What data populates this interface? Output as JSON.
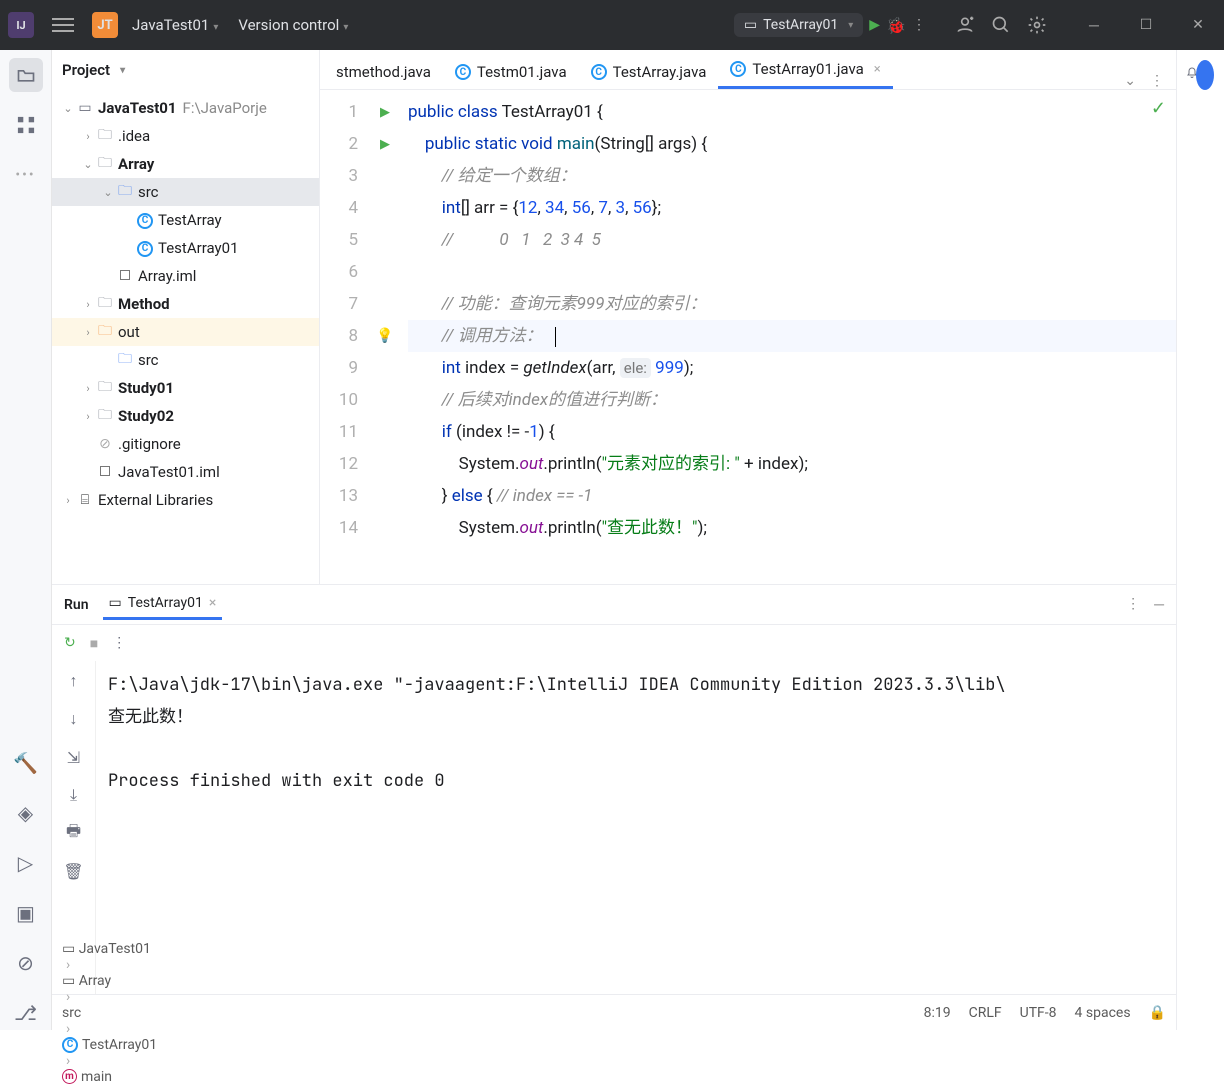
{
  "titlebar": {
    "app_icon": "IJ",
    "project_badge": "JT",
    "project_name": "JavaTest01",
    "vcs_label": "Version control",
    "run_config": "TestArray01"
  },
  "project_panel": {
    "label": "Project",
    "tree": [
      {
        "depth": 0,
        "twisty": "v",
        "icon": "module",
        "label": "JavaTest01",
        "bold": true,
        "path": "F:\\JavaPorje"
      },
      {
        "depth": 1,
        "twisty": ">",
        "icon": "folder",
        "label": ".idea"
      },
      {
        "depth": 1,
        "twisty": "v",
        "icon": "folder",
        "label": "Array",
        "bold": true
      },
      {
        "depth": 2,
        "twisty": "v",
        "icon": "folder-blue",
        "label": "src",
        "sel": true
      },
      {
        "depth": 3,
        "twisty": "",
        "icon": "class",
        "label": "TestArray"
      },
      {
        "depth": 3,
        "twisty": "",
        "icon": "class",
        "label": "TestArray01"
      },
      {
        "depth": 2,
        "twisty": "",
        "icon": "file",
        "label": "Array.iml"
      },
      {
        "depth": 1,
        "twisty": ">",
        "icon": "folder",
        "label": "Method",
        "bold": true
      },
      {
        "depth": 1,
        "twisty": ">",
        "icon": "folder-orange",
        "label": "out",
        "out": true
      },
      {
        "depth": 2,
        "twisty": "",
        "icon": "folder-blue",
        "label": "src"
      },
      {
        "depth": 1,
        "twisty": ">",
        "icon": "folder",
        "label": "Study01",
        "bold": true
      },
      {
        "depth": 1,
        "twisty": ">",
        "icon": "folder",
        "label": "Study02",
        "bold": true
      },
      {
        "depth": 1,
        "twisty": "",
        "icon": "ignore",
        "label": ".gitignore"
      },
      {
        "depth": 1,
        "twisty": "",
        "icon": "file",
        "label": "JavaTest01.iml"
      },
      {
        "depth": 0,
        "twisty": ">",
        "icon": "lib",
        "label": "External Libraries"
      }
    ]
  },
  "tabs": [
    {
      "label": "stmethod.java",
      "icon": "none"
    },
    {
      "label": "Testm01.java",
      "icon": "class"
    },
    {
      "label": "TestArray.java",
      "icon": "class"
    },
    {
      "label": "TestArray01.java",
      "icon": "class",
      "active": true,
      "closeable": true
    }
  ],
  "code_lines": [
    {
      "n": 1,
      "run": true,
      "html": "<span class='kw'>public class</span> TestArray01 {"
    },
    {
      "n": 2,
      "run": true,
      "html": "    <span class='kw'>public static void</span> <span style='color:#00627a'>main</span>(String[] args) {"
    },
    {
      "n": 3,
      "html": "        <span class='cmt'>// 给定一个数组：</span>"
    },
    {
      "n": 4,
      "html": "        <span class='kw'>int</span>[] arr = {<span class='num'>12</span>, <span class='num'>34</span>, <span class='num'>56</span>, <span class='num'>7</span>, <span class='num'>3</span>, <span class='num'>56</span>};"
    },
    {
      "n": 5,
      "html": "        <span class='cmt'>//           0   1   2  3 4  5</span>"
    },
    {
      "n": 6,
      "html": ""
    },
    {
      "n": 7,
      "html": "        <span class='cmt'>// 功能：查询元素999对应的索引：</span>"
    },
    {
      "n": 8,
      "bulb": true,
      "hl": true,
      "html": "        <span class='cmt'>// 调用方法：</span>   <span class='cursor'></span>"
    },
    {
      "n": 9,
      "html": "        <span class='kw'>int</span> index = <span style='font-style:italic'>getIndex</span>(arr, <span class='hint'>ele:</span> <span class='num'>999</span>);"
    },
    {
      "n": 10,
      "html": "        <span class='cmt'>// 后续对index的值进行判断：</span>"
    },
    {
      "n": 11,
      "html": "        <span class='kw'>if</span> (index != -<span class='num'>1</span>) {"
    },
    {
      "n": 12,
      "html": "            System.<span class='fld'>out</span>.println(<span class='str'>\"元素对应的索引: \"</span> + index);"
    },
    {
      "n": 13,
      "html": "        } <span class='kw'>else</span> { <span class='cmt'>// index == -1</span>"
    },
    {
      "n": 14,
      "html": "            System.<span class='fld'>out</span>.println(<span class='str'>\"查无此数！\"</span>);"
    }
  ],
  "run_panel": {
    "title": "Run",
    "tab": "TestArray01",
    "output": [
      "F:\\Java\\jdk-17\\bin\\java.exe \"-javaagent:F:\\IntelliJ IDEA Community Edition 2023.3.3\\lib\\",
      "查无此数！",
      "",
      "Process finished with exit code 0"
    ]
  },
  "breadcrumbs": [
    "JavaTest01",
    "Array",
    "src",
    "TestArray01",
    "main"
  ],
  "statusbar": {
    "pos": "8:19",
    "eol": "CRLF",
    "encoding": "UTF-8",
    "indent": "4 spaces"
  }
}
